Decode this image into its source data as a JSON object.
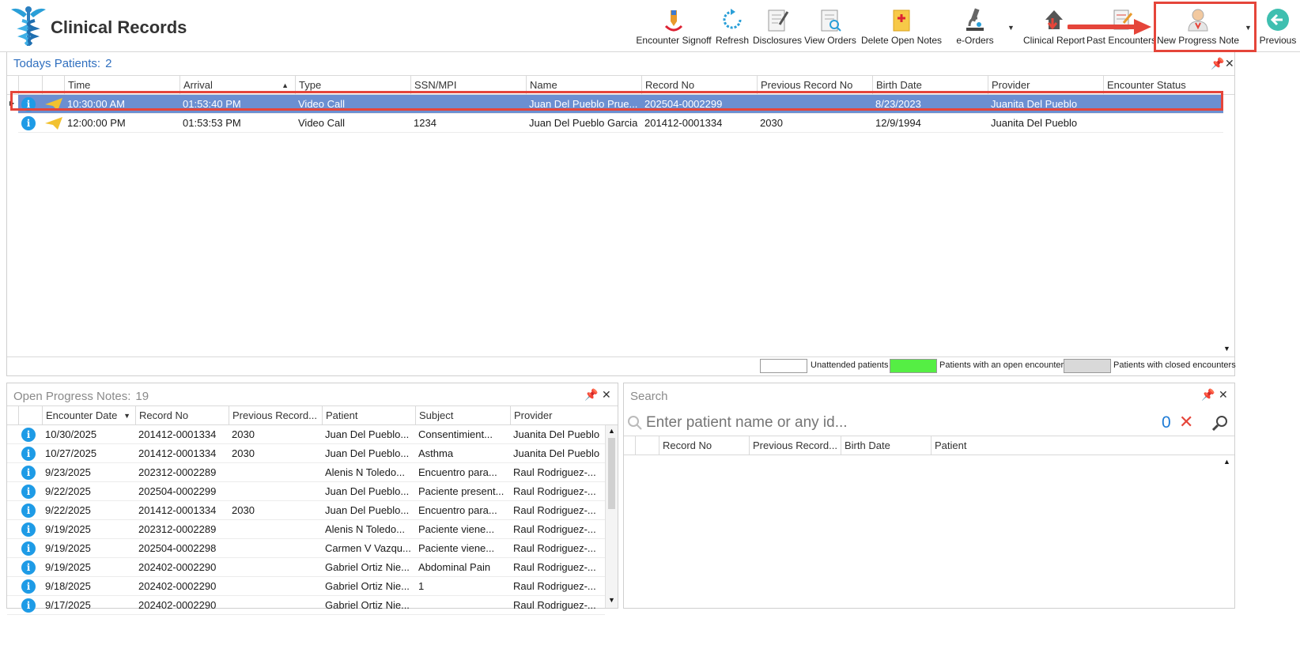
{
  "app": {
    "title": "Clinical Records"
  },
  "toolbar": {
    "encounter_signoff": "Encounter Signoff",
    "refresh": "Refresh",
    "disclosures": "Disclosures",
    "view_orders": "View Orders",
    "delete_open_notes": "Delete Open Notes",
    "e_orders": "e-Orders",
    "clinical_report": "Clinical Report",
    "past_encounters": "Past Encounters",
    "new_progress_note": "New Progress Note",
    "previous": "Previous"
  },
  "todays": {
    "title": "Todays Patients:",
    "count": "2",
    "columns": [
      "Time",
      "Arrival",
      "Type",
      "SSN/MPI",
      "Name",
      "Record No",
      "Previous Record No",
      "Birth Date",
      "Provider",
      "Encounter Status"
    ],
    "rows": [
      [
        "10:30:00 AM",
        "01:53:40 PM",
        "Video Call",
        "",
        "Juan Del Pueblo Prue...",
        "202504-0002299",
        "",
        "8/23/2023",
        "Juanita Del Pueblo",
        ""
      ],
      [
        "12:00:00 PM",
        "01:53:53 PM",
        "Video Call",
        "1234",
        "Juan Del Pueblo Garcia",
        "201412-0001334",
        "2030",
        "12/9/1994",
        "Juanita Del Pueblo",
        ""
      ]
    ],
    "legend": {
      "unattended": "Unattended patients",
      "open": "Patients with an open encounter",
      "closed": "Patients with closed encounters"
    }
  },
  "notes": {
    "title": "Open Progress Notes:",
    "count": "19",
    "columns": [
      "Encounter Date",
      "Record No",
      "Previous Record...",
      "Patient",
      "Subject",
      "Provider"
    ],
    "rows": [
      [
        "10/30/2025",
        "201412-0001334",
        "2030",
        "Juan Del Pueblo...",
        "Consentimient...",
        "Juanita Del Pueblo"
      ],
      [
        "10/27/2025",
        "201412-0001334",
        "2030",
        "Juan Del Pueblo...",
        "Asthma",
        "Juanita Del Pueblo"
      ],
      [
        "9/23/2025",
        "202312-0002289",
        "",
        "Alenis N Toledo...",
        "Encuentro para...",
        "Raul Rodriguez-..."
      ],
      [
        "9/22/2025",
        "202504-0002299",
        "",
        "Juan Del Pueblo...",
        "Paciente present...",
        "Raul Rodriguez-..."
      ],
      [
        "9/22/2025",
        "201412-0001334",
        "2030",
        "Juan Del Pueblo...",
        "Encuentro para...",
        "Raul Rodriguez-..."
      ],
      [
        "9/19/2025",
        "202312-0002289",
        "",
        "Alenis N Toledo...",
        "Paciente viene...",
        "Raul Rodriguez-..."
      ],
      [
        "9/19/2025",
        "202504-0002298",
        "",
        "Carmen V Vazqu...",
        "Paciente viene...",
        "Raul Rodriguez-..."
      ],
      [
        "9/19/2025",
        "202402-0002290",
        "",
        "Gabriel Ortiz Nie...",
        "Abdominal Pain",
        "Raul Rodriguez-..."
      ],
      [
        "9/18/2025",
        "202402-0002290",
        "",
        "Gabriel Ortiz Nie...",
        "1",
        "Raul Rodriguez-..."
      ],
      [
        "9/17/2025",
        "202402-0002290",
        "",
        "Gabriel Ortiz Nie...",
        "",
        "Raul Rodriguez-..."
      ]
    ]
  },
  "search": {
    "title": "Search",
    "placeholder": "Enter patient name or any id...",
    "result_count": "0",
    "columns": [
      "Record No",
      "Previous Record...",
      "Birth Date",
      "Patient"
    ]
  },
  "colors": {
    "selection": "#6b8fd1",
    "highlight_border": "#e5453a",
    "open_encounter": "#55ee44",
    "closed_encounter": "#d9d9d9",
    "info_icon": "#1e9be6"
  }
}
